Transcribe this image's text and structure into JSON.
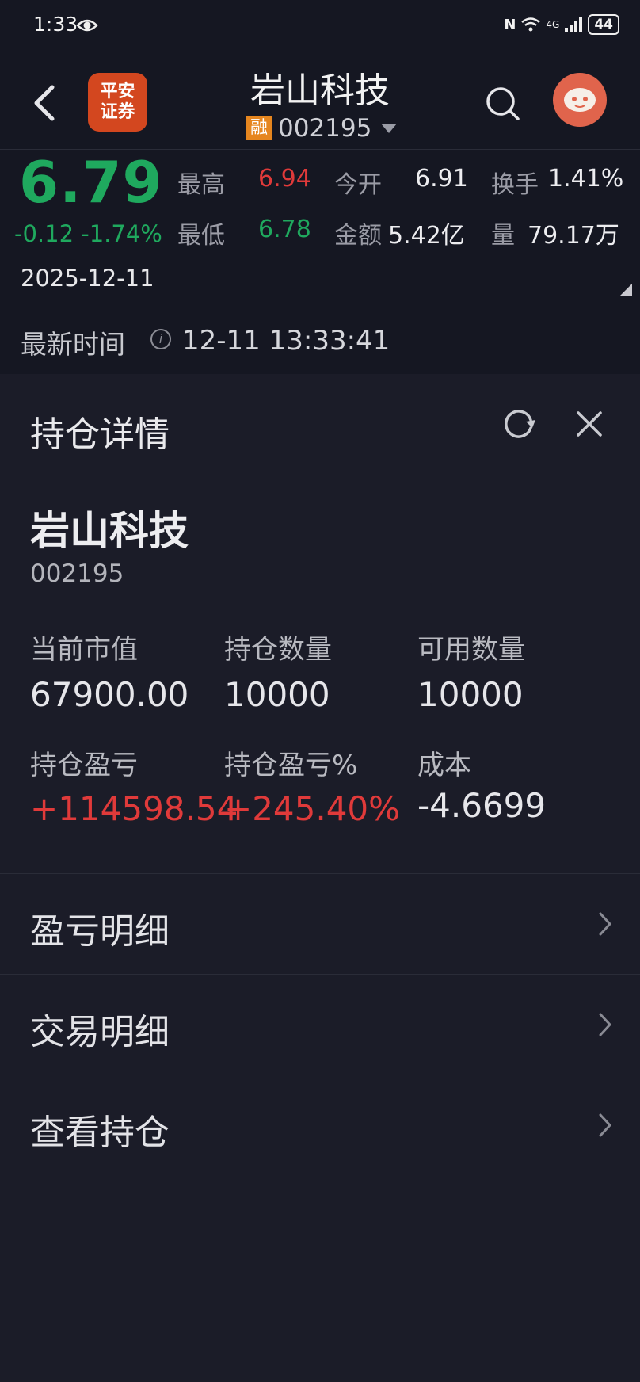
{
  "status_bar": {
    "time": "1:33",
    "network": "4G",
    "battery": "44"
  },
  "header": {
    "logo_line1": "平安",
    "logo_line2": "证券",
    "stock_name": "岩山科技",
    "margin_badge": "融",
    "stock_code": "002195"
  },
  "quote": {
    "price": "6.79",
    "change": "-0.12 -1.74%",
    "date": "2025-12-11",
    "high_label": "最高",
    "high": "6.94",
    "low_label": "最低",
    "low": "6.78",
    "open_label": "今开",
    "open": "6.91",
    "amount_label": "金额",
    "amount": "5.42亿",
    "turnover_label": "换手",
    "turnover": "1.41%",
    "volume_label": "量",
    "volume": "79.17万",
    "latest_label": "最新时间",
    "latest_time": "12-11 13:33:41"
  },
  "position": {
    "panel_title": "持仓详情",
    "stock_name": "岩山科技",
    "stock_code": "002195",
    "market_value_label": "当前市值",
    "market_value": "67900.00",
    "qty_label": "持仓数量",
    "qty": "10000",
    "avail_label": "可用数量",
    "avail": "10000",
    "pnl_label": "持仓盈亏",
    "pnl": "+114598.54",
    "pnl_pct_label": "持仓盈亏%",
    "pnl_pct": "+245.40%",
    "cost_label": "成本",
    "cost": "-4.6699"
  },
  "menu": [
    {
      "label": "盈亏明细"
    },
    {
      "label": "交易明细"
    },
    {
      "label": "查看持仓"
    }
  ],
  "colors": {
    "up": "#e03a3a",
    "down": "#1fa95e",
    "bg": "#1b1c28"
  }
}
